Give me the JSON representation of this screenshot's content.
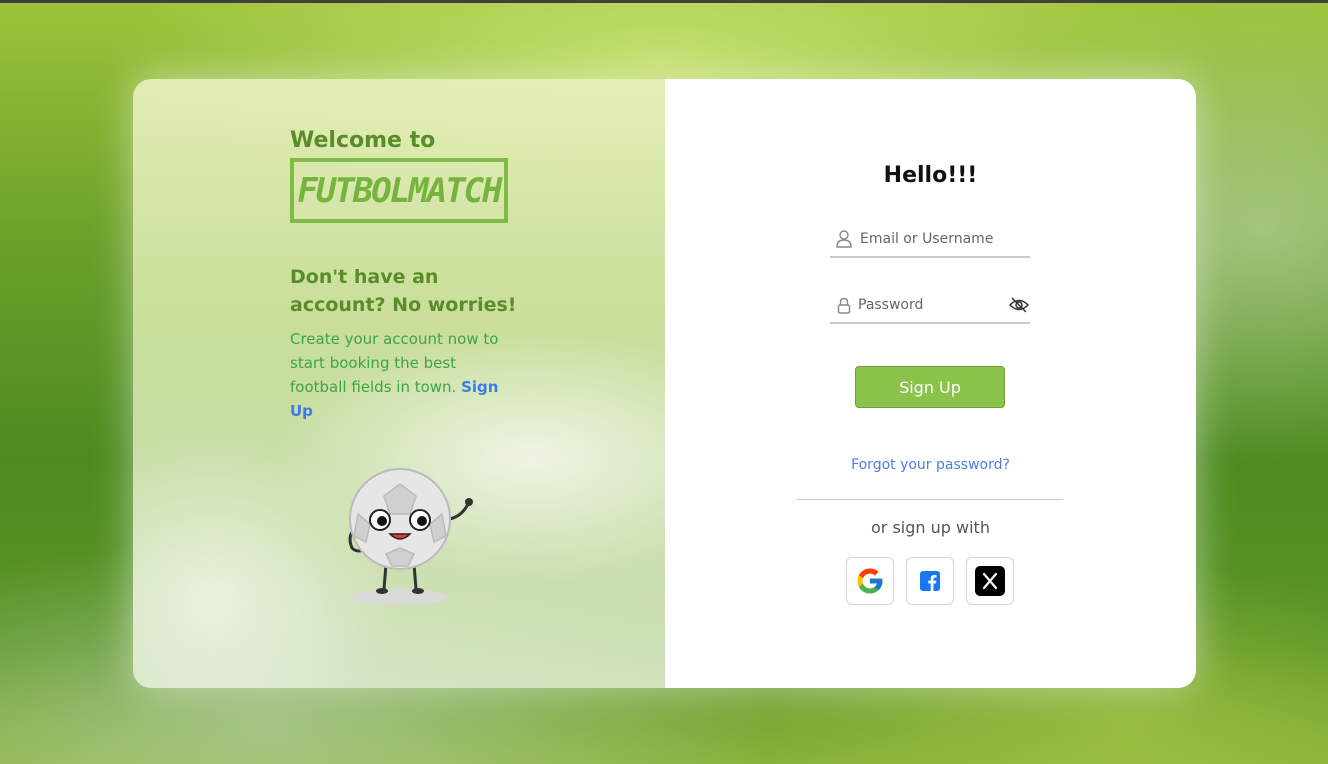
{
  "brand": {
    "welcome": "Welcome to",
    "logo_text": "FUTBOLMATCH"
  },
  "promo": {
    "heading": "Don't have an account? No worries!",
    "text": "Create your account now to start booking the best football fields in town.",
    "signup_link": "Sign Up"
  },
  "login": {
    "greeting": "Hello!!!",
    "email_placeholder": "Email or Username",
    "password_placeholder": "Password",
    "submit_label": "Sign Up",
    "forgot_link": "Forgot your password?",
    "alt_text": "or sign up with"
  },
  "social_buttons": [
    {
      "icon": "google-icon"
    },
    {
      "icon": "facebook-icon"
    },
    {
      "icon": "x-icon"
    }
  ],
  "colors": {
    "accent_green": "#8bc34a",
    "heading_green": "#5a8c2c",
    "link_blue": "#4a7fe0"
  }
}
